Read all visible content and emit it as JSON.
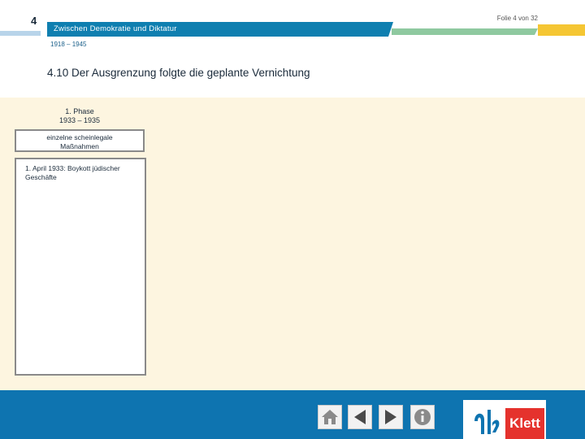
{
  "header": {
    "chapter_number": "4",
    "title": "Zwischen Demokratie und Diktatur",
    "subtitle": "1918 – 1945",
    "slide_counter": "Folie 4 von 32"
  },
  "slide": {
    "title": "4.10 Der Ausgrenzung folgte die geplante Vernichtung",
    "phase_label_line1": "1. Phase",
    "phase_label_line2": "1933 – 1935",
    "measures_line1": "einzelne scheinlegale",
    "measures_line2": "Maßnahmen",
    "detail_line1": "1. April 1933: Boykott jüdischer",
    "detail_line2": "Geschäfte"
  },
  "navigation": {
    "home_icon": "home-icon",
    "prev_icon": "arrow-left-icon",
    "next_icon": "arrow-right-icon",
    "info_icon": "info-icon"
  },
  "brand": {
    "logo_text": "Klett",
    "colors": {
      "primary_blue": "#0e74b0",
      "header_blue": "#0f7fb0",
      "accent_green": "#8fc9a0",
      "accent_yellow": "#f5c633",
      "logo_red": "#e5322d",
      "content_bg": "#fdf5e0"
    }
  }
}
